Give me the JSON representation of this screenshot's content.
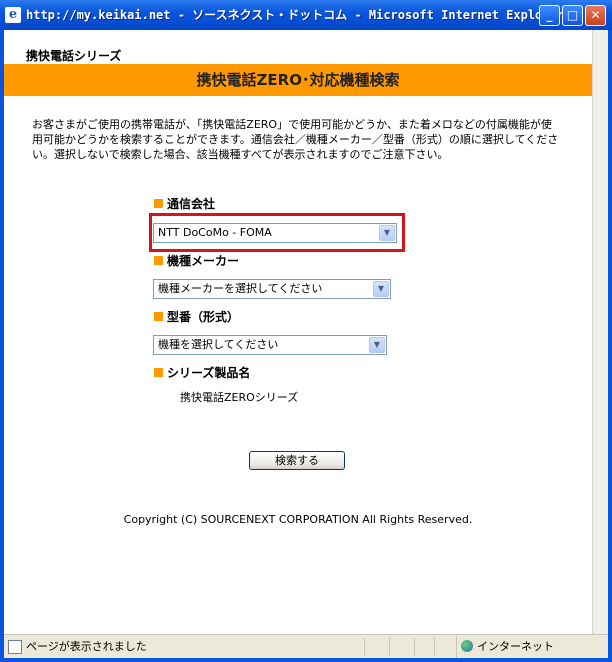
{
  "window": {
    "title": "http://my.keikai.net - ソースネクスト・ドットコム - Microsoft Internet Explorer",
    "minimize": "_",
    "maximize": "□",
    "close": "✕"
  },
  "page": {
    "series_label": "携快電話シリーズ",
    "header_title": "携快電話ZERO･対応機種検索",
    "intro": "お客さまがご使用の携帯電話が、「携快電話ZERO」で使用可能かどうか、また着メロなどの付属機能が使用可能かどうかを検索することができます。通信会社／機種メーカー／型番（形式）の順に選択してください。選択しないで検索した場合、該当機種すべてが表示されますのでご注意下さい。",
    "carrier": {
      "label": "通信会社",
      "selected": "NTT DoCoMo - FOMA"
    },
    "maker": {
      "label": "機種メーカー",
      "selected": "機種メーカーを選択してください"
    },
    "model": {
      "label": "型番（形式）",
      "selected": "機種を選択してください"
    },
    "product": {
      "label": "シリーズ製品名",
      "value": "携快電話ZEROシリーズ"
    },
    "search_button": "検索する",
    "copyright": "Copyright (C) SOURCENEXT CORPORATION All Rights Reserved."
  },
  "statusbar": {
    "status_text": "ページが表示されました",
    "zone": "インターネット"
  },
  "icons": {
    "dropdown": "▼",
    "ie": "e"
  },
  "colors": {
    "accent_orange": "#FF9900",
    "highlight_red": "#D4141B",
    "titlebar_blue": "#0A55E0"
  }
}
